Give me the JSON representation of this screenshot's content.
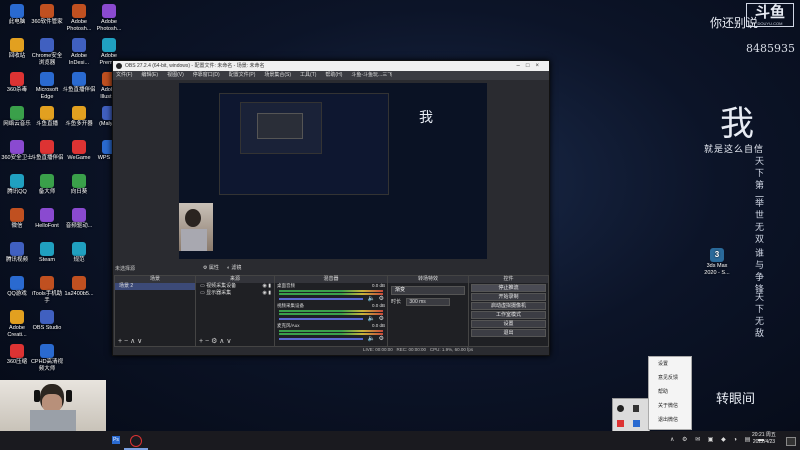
{
  "desktop": {
    "icons_col1": [
      "此电脑",
      "回收站",
      "360杀毒",
      "网络云音乐",
      "360安全卫士",
      "腾讯QQ",
      "微信",
      "腾讯视频",
      "QQ游戏",
      "Adobe Creati...",
      "360压缩"
    ],
    "icons_col2": [
      "360软件管家",
      "Chrome安全浏览器",
      "Microsoft Edge",
      "斗鱼直播",
      "斗鱼直播伴侣",
      "备大师",
      "HelloFont",
      "Steam",
      "iTools手机助手",
      "OBS Studio",
      "CPHD高清视频大师"
    ],
    "icons_col3": [
      "Adobe Photosh...",
      "Adobe InDesi...",
      "斗鱼直播伴侣",
      "斗鱼多开器",
      "WeGame",
      "向日葵",
      "音频驱动...",
      "规范",
      "1a2400b5...",
      ""
    ],
    "icons_col4": [
      "Adobe Photosh...",
      "Adobe Premi...",
      "Adobe Illustr...",
      "(Maly)...",
      "WPS C...",
      ""
    ],
    "right_icon_label": "3ds Max 2020 - S..."
  },
  "wallpaper": {
    "logo": "斗鱼",
    "logo_sub": "DOUYU.COM",
    "top_text": "你还别说",
    "room_id": "8485935",
    "big_char": "我",
    "tagline": "就是这么自信",
    "vertical_1": "天下第一",
    "vertical_2": "举世无双",
    "vertical_3": "谁与争锋",
    "vertical_4": "天下无敌",
    "bottom_text": "转眼间"
  },
  "obs": {
    "title": "OBS 27.2.4 (64-bit, windows) - 配置文件: 未命名 - 场景: 未命名",
    "menu": [
      "文件(F)",
      "编辑(E)",
      "视图(V)",
      "停靠窗口(D)",
      "配置文件(P)",
      "场景集合(S)",
      "工具(T)",
      "帮助(H)",
      "斗鱼-斗鱼玩...三飞"
    ],
    "source_hint": "未选择源",
    "prop_btn": "属性",
    "filter_btn": "滤镜",
    "panels": {
      "scenes": "场景",
      "sources": "来源",
      "mixer": "混音器",
      "transitions": "转场特效",
      "controls": "控件"
    },
    "scenes": [
      "场景 2"
    ],
    "sources": [
      "视频采集设备",
      "显示器采集"
    ],
    "mixer": [
      {
        "name": "桌面音频",
        "db": "0.0 dB"
      },
      {
        "name": "视频采集设备",
        "db": "0.0 dB"
      },
      {
        "name": "麦克风/Aux",
        "db": "0.0 dB"
      }
    ],
    "transition_type": "渐变",
    "duration_label": "时长",
    "duration_value": "300 ms",
    "controls": [
      "停止推流",
      "开始录制",
      "启动虚拟摄像机",
      "工作室模式",
      "设置",
      "退出"
    ],
    "status": [
      "LIVE: 00:00:00",
      "REC: 00:00:00",
      "CPU: 1.9%, 60.00 fps"
    ]
  },
  "tray_menu": [
    "设置",
    "意见反馈",
    "帮助",
    "关于微信",
    "退出微信"
  ],
  "taskbar": {
    "time": "20:21 周五",
    "date": "2022/4/23"
  }
}
